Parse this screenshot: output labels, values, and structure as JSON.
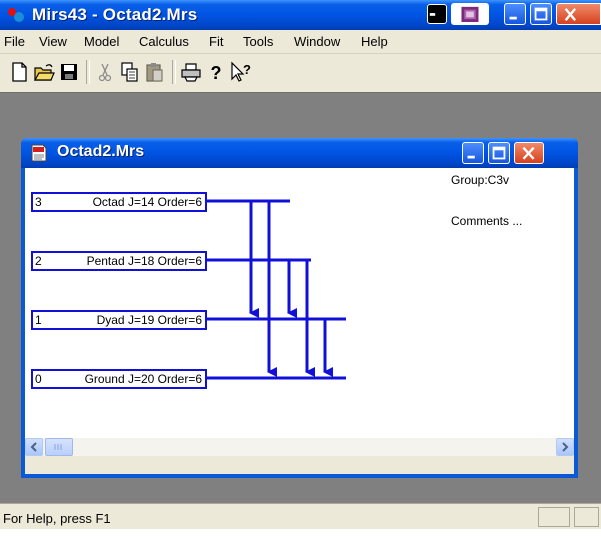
{
  "app": {
    "title": "Mirs43 - Octad2.Mrs"
  },
  "menu": [
    "File",
    "View",
    "Model",
    "Calculus",
    "Fit",
    "Tools",
    "Window",
    "Help"
  ],
  "toolbar": {
    "buttons": [
      "new-icon",
      "open-icon",
      "save-icon",
      "cut-icon",
      "copy-icon",
      "paste-icon",
      "print-icon",
      "help-icon",
      "context-help-icon"
    ]
  },
  "document": {
    "title": "Octad2.Mrs",
    "group": "Group:C3v",
    "comments": "Comments ...",
    "levels": [
      {
        "num": "3",
        "label": "Octad J=14 Order=6"
      },
      {
        "num": "2",
        "label": "Pentad J=18 Order=6"
      },
      {
        "num": "1",
        "label": "Dyad J=19 Order=6"
      },
      {
        "num": "0",
        "label": "Ground J=20 Order=6"
      }
    ]
  },
  "status": {
    "text": "For Help, press F1"
  },
  "colors": {
    "diagram": "#1010d8",
    "titlebar": "#0054e3"
  }
}
